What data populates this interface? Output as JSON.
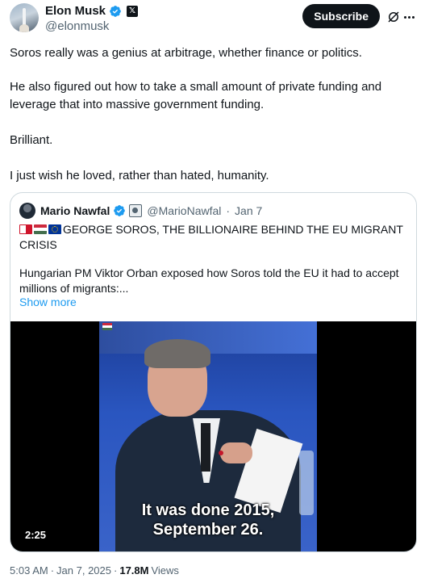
{
  "author": {
    "name": "Elon Musk",
    "handle": "@elonmusk"
  },
  "actions": {
    "subscribe_label": "Subscribe"
  },
  "tweet": {
    "paragraphs": [
      "Soros really was a genius at arbitrage, whether finance or politics.",
      "He also figured out how to take a small amount of private funding and leverage that into massive government funding.",
      "Brilliant.",
      "I just wish he loved, rather than hated, humanity."
    ]
  },
  "quote": {
    "name": "Mario Nawfal",
    "handle": "@MarioNawfal",
    "separator": "·",
    "date": "Jan 7",
    "flags": [
      "malta-flag",
      "hungary-flag",
      "eu-flag"
    ],
    "headline": "GEORGE SOROS, THE BILLIONAIRE BEHIND THE EU MIGRANT CRISIS",
    "body": "Hungarian PM Viktor Orban exposed how Soros told the EU it had to accept millions of migrants:...",
    "show_more": "Show more"
  },
  "video": {
    "caption_line1": "It was done 2015,",
    "caption_line2": "September 26.",
    "duration": "2:25"
  },
  "footer": {
    "time": "5:03 AM",
    "separator": "·",
    "date": "Jan 7, 2025",
    "views_count": "17.8M",
    "views_label": "Views"
  },
  "colors": {
    "link": "#1d9bf0",
    "verified": "#1d9bf0",
    "text": "#0f1419",
    "muted": "#536471",
    "border": "#cfd9de"
  }
}
